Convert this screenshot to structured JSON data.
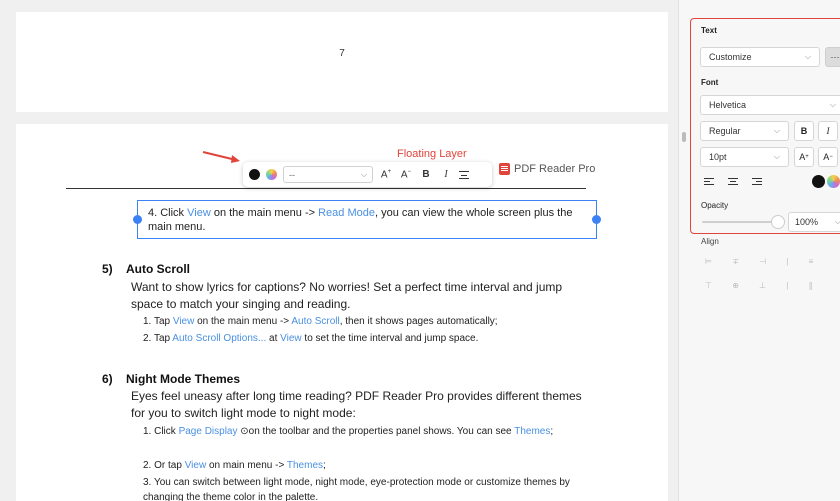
{
  "document": {
    "page_number": "7",
    "header_brand": "PDF Reader Pro",
    "annotation_label": "Floating Layer",
    "selected_item": {
      "prefix": "4. Click ",
      "link1": "View",
      "mid1": " on the main menu -> ",
      "link2": "Read Mode",
      "suffix": ", you can view the whole screen plus the main menu."
    },
    "auto_scroll": {
      "number": "5)",
      "title": "Auto Scroll",
      "para": "Want to show lyrics for captions? No worries! Set a perfect time interval and jump space to match your singing and reading.",
      "item1": {
        "prefix": "1. Tap ",
        "link1": "View",
        "mid": " on the main menu -> ",
        "link2": "Auto Scroll",
        "suffix": ", then it shows pages automatically;"
      },
      "item2": {
        "prefix": "2. Tap ",
        "link1": "Auto Scroll Options...",
        "mid": " at ",
        "link2": "View",
        "suffix": " to set the time interval and jump space."
      }
    },
    "night_mode": {
      "number": "6)",
      "title": "Night Mode Themes",
      "para": "Eyes feel uneasy after long time reading? PDF Reader Pro provides different themes for you to switch light mode to night mode:",
      "item1": {
        "prefix": "1. Click ",
        "link1": "Page Display",
        "mid": " ⊙on the toolbar and the properties panel shows. You can see ",
        "link2": "Themes",
        "suffix": ";"
      },
      "item2": {
        "prefix": "2. Or tap ",
        "link1": "View",
        "mid": " on main menu -> ",
        "link2": "Themes",
        "suffix": ";"
      },
      "item3": "3. You can switch between light mode, night mode, eye-protection mode or customize themes by changing the theme color in the palette."
    }
  },
  "floating_toolbar": {
    "font_value": "--",
    "increase_label": "A",
    "increase_sup": "+",
    "decrease_label": "A",
    "decrease_sup": "−",
    "bold_label": "B",
    "italic_label": "I"
  },
  "panel": {
    "text_label": "Text",
    "style_value": "Customize",
    "more_label": "···",
    "font_label": "Font",
    "font_family": "Helvetica",
    "font_weight": "Regular",
    "bold_label": "B",
    "italic_label": "I",
    "font_size": "10pt",
    "increase_label": "A",
    "increase_sup": "+",
    "decrease_label": "A",
    "decrease_sup": "−",
    "opacity_label": "Opacity",
    "opacity_value": "100%",
    "opacity_fraction": 1.0,
    "align_label": "Align",
    "align_row1": "⊨ ∓ ⊣ | ≡",
    "align_row2": "⊤ ⊕ ⊥ | ∥"
  },
  "colors": {
    "accent": "#3b82f6",
    "link": "#4a90e2",
    "annotation": "#e0443a"
  }
}
